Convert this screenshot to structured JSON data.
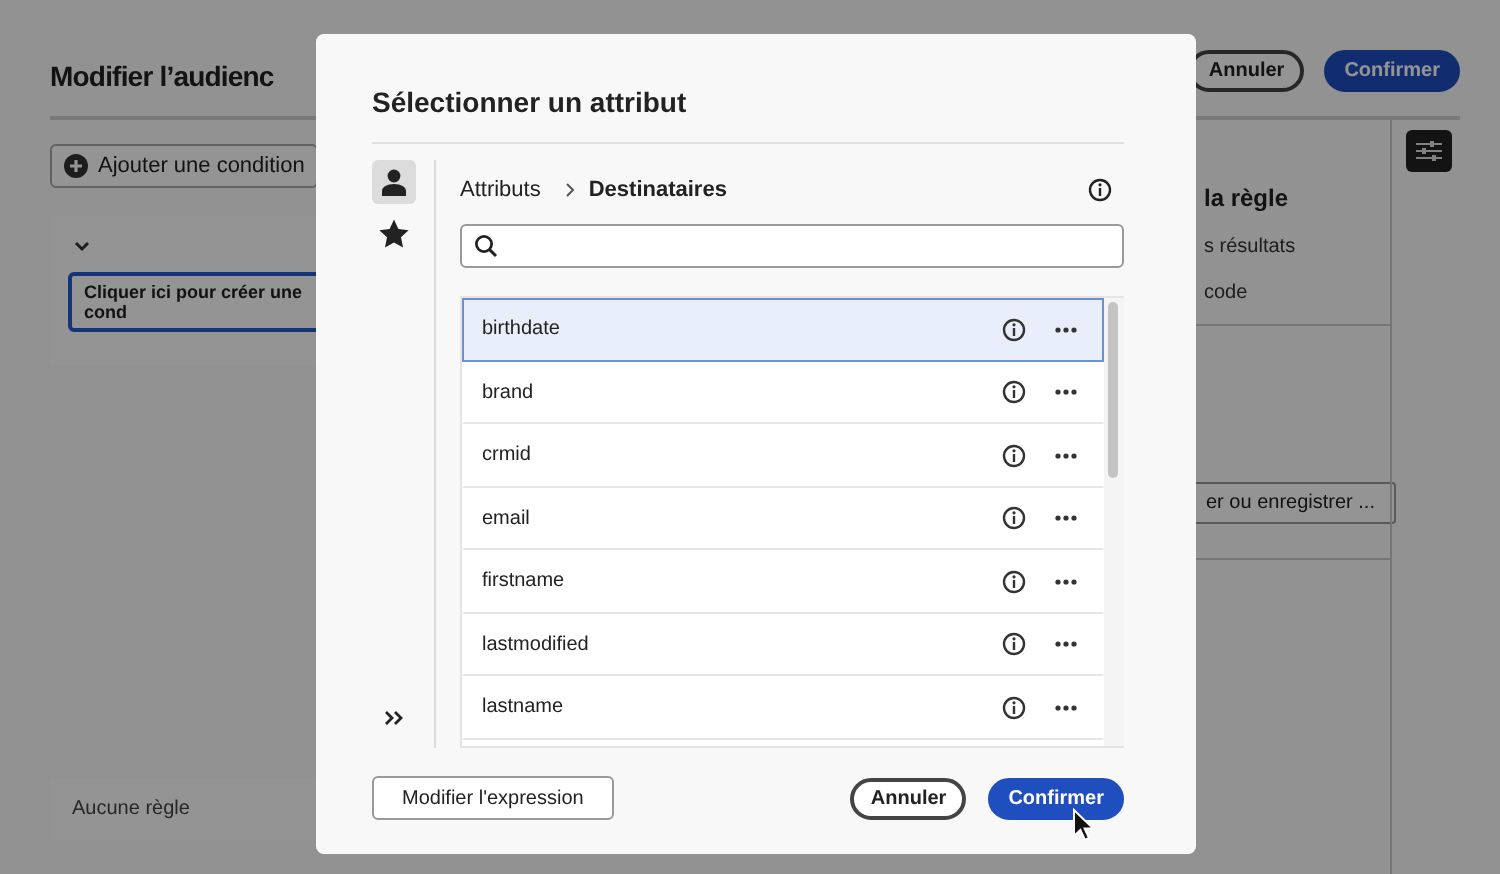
{
  "page": {
    "title": "Modifier l’audienc",
    "buttons": [
      {
        "label": "Annuler",
        "kind": "secondary"
      },
      {
        "label": "Confirmer",
        "kind": "primary"
      }
    ],
    "add_condition": "Ajouter une condition",
    "canvas": {
      "expanded": true,
      "condition_placeholder": "Cliquer ici pour créer une cond"
    },
    "side_panel": {
      "title": "la règle",
      "links": [
        "s résultats",
        "code"
      ],
      "button": "er ou enregistrer ..."
    },
    "footer": "Aucune règle"
  },
  "dialog": {
    "title": "Sélectionner un attribut",
    "rail": [
      {
        "kind": "person",
        "selected": true
      },
      {
        "kind": "star",
        "selected": false
      }
    ],
    "breadcrumb": [
      "Attributs",
      "Destinataires"
    ],
    "attributes": [
      {
        "name": "birthdate",
        "selected": true
      },
      {
        "name": "brand",
        "selected": false
      },
      {
        "name": "crmid",
        "selected": false
      },
      {
        "name": "email",
        "selected": false
      },
      {
        "name": "firstname",
        "selected": false
      },
      {
        "name": "lastmodified",
        "selected": false
      },
      {
        "name": "lastname",
        "selected": false
      }
    ],
    "edit_expression": "Modifier l'expression",
    "buttons": [
      {
        "label": "Annuler",
        "kind": "secondary"
      },
      {
        "label": "Confirmer",
        "kind": "primary"
      }
    ]
  }
}
